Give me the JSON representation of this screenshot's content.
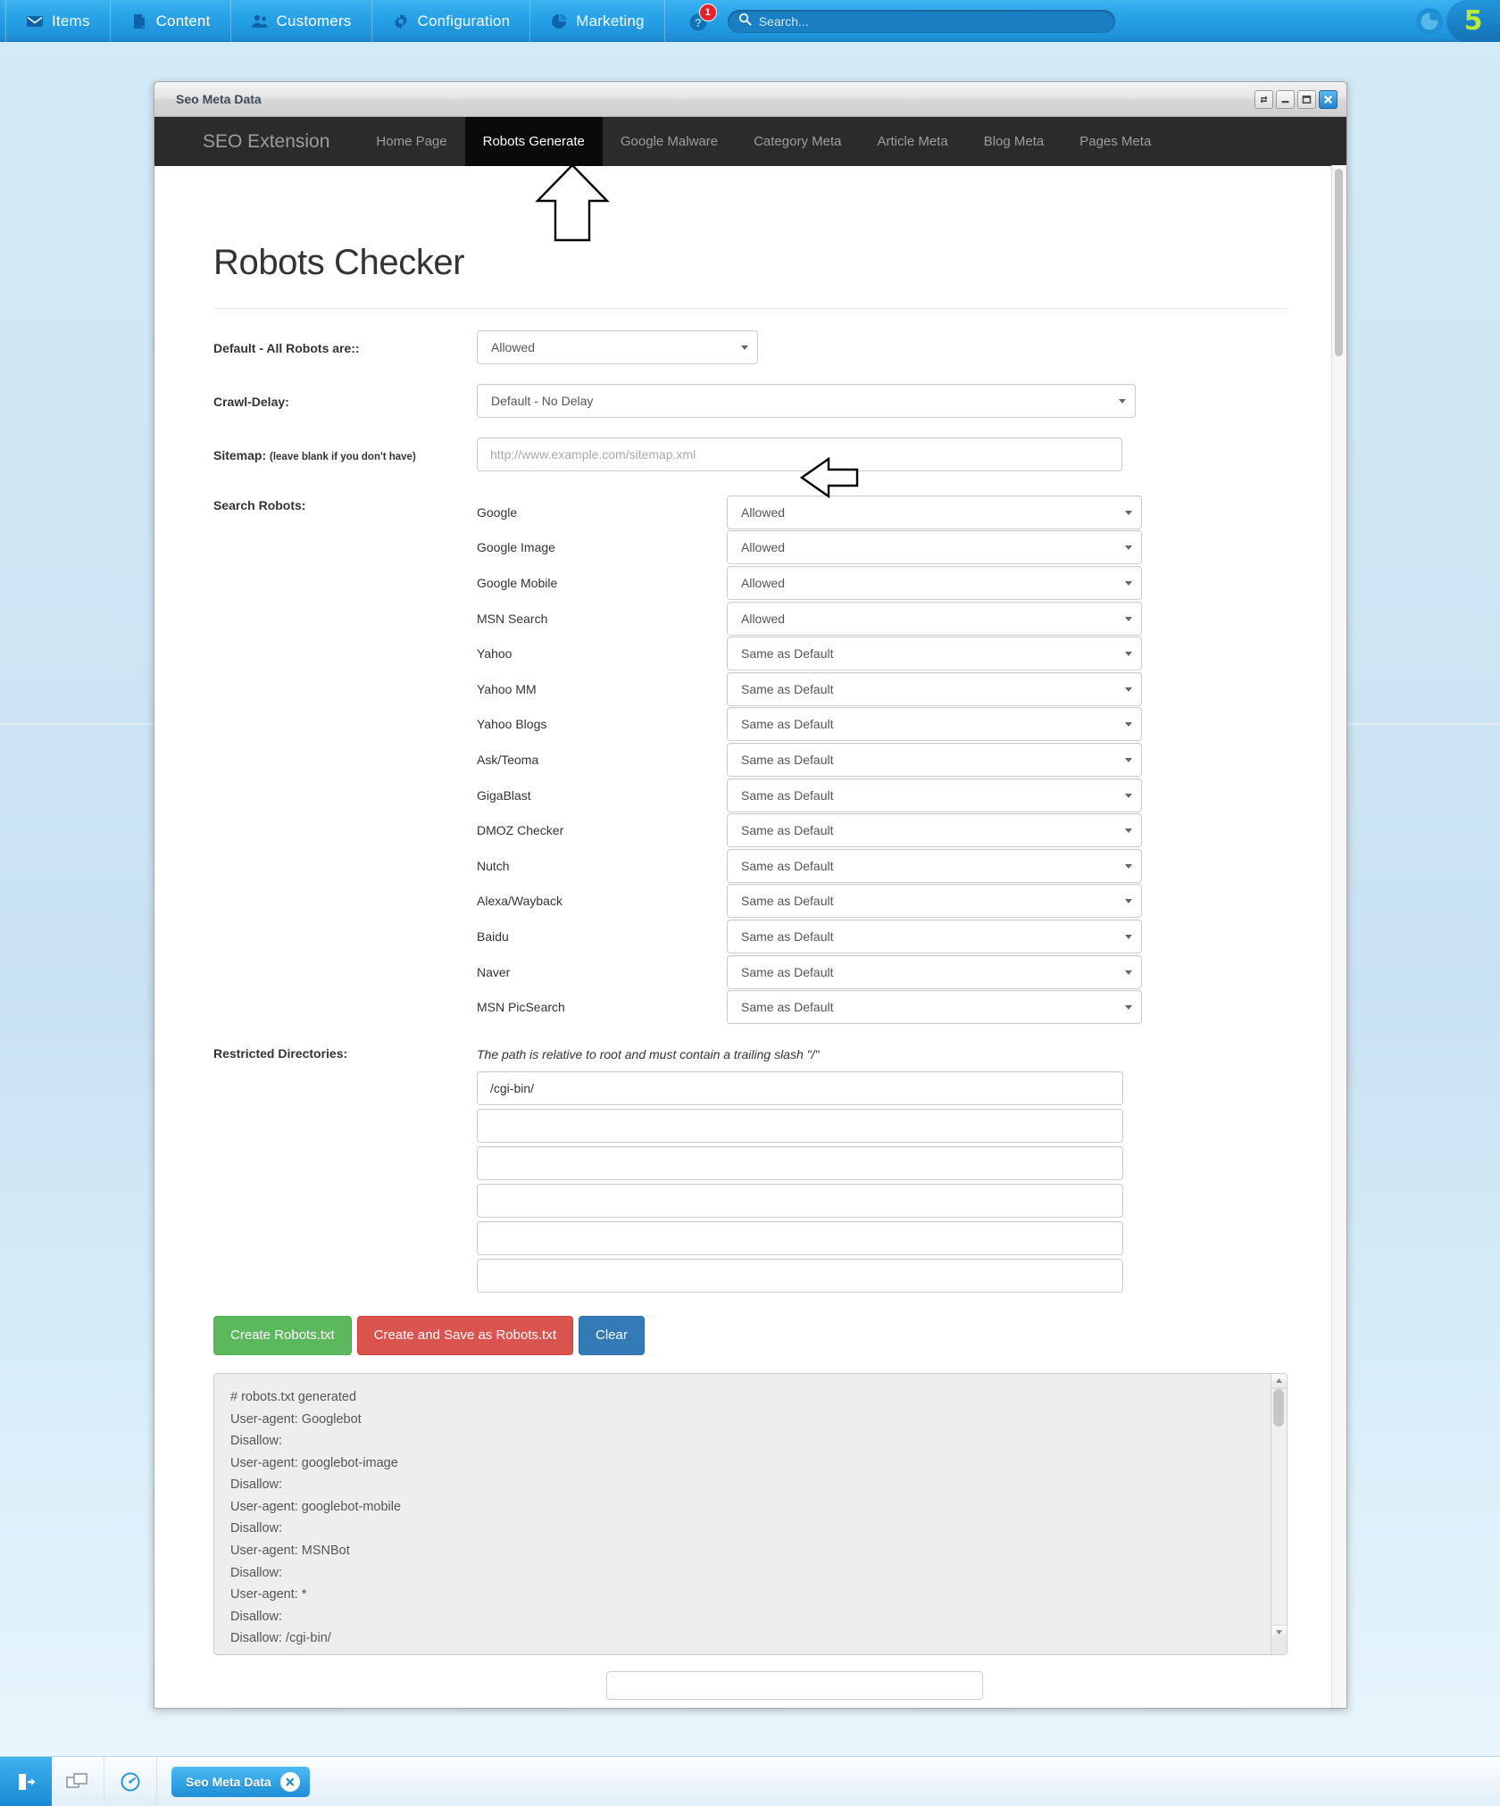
{
  "topbar": {
    "menu": [
      {
        "label": "Items",
        "icon": "inbox-icon"
      },
      {
        "label": "Content",
        "icon": "document-icon"
      },
      {
        "label": "Customers",
        "icon": "users-icon"
      },
      {
        "label": "Configuration",
        "icon": "gear-icon"
      },
      {
        "label": "Marketing",
        "icon": "pie-chart-icon"
      }
    ],
    "help_icon": "help-icon",
    "help_badge": "1",
    "search_placeholder": "Search...",
    "brand_mark": "5",
    "accent_color": "#1d8ed6",
    "badge_color": "#e8202a",
    "brand_color": "#b9e83b"
  },
  "window": {
    "title": "Seo Meta Data",
    "controls": [
      "restore-icon",
      "minimize-icon",
      "maximize-icon",
      "close-icon"
    ]
  },
  "nav": {
    "brand": "SEO Extension",
    "tabs": [
      {
        "label": "Home Page",
        "active": false
      },
      {
        "label": "Robots Generate",
        "active": true
      },
      {
        "label": "Google Malware",
        "active": false
      },
      {
        "label": "Category Meta",
        "active": false
      },
      {
        "label": "Article Meta",
        "active": false
      },
      {
        "label": "Blog Meta",
        "active": false
      },
      {
        "label": "Pages Meta",
        "active": false
      }
    ]
  },
  "page": {
    "title": "Robots Checker",
    "default_robots": {
      "label": "Default - All Robots are::",
      "value": "Allowed"
    },
    "crawl_delay": {
      "label": "Crawl-Delay:",
      "value": "Default - No Delay"
    },
    "sitemap": {
      "label": "Sitemap:",
      "sub_label": "(leave blank if you don't have)",
      "value": "",
      "placeholder": "http://www.example.com/sitemap.xml"
    },
    "search_robots": {
      "label": "Search Robots:",
      "rows": [
        {
          "name": "Google",
          "value": "Allowed"
        },
        {
          "name": "Google Image",
          "value": "Allowed"
        },
        {
          "name": "Google Mobile",
          "value": "Allowed"
        },
        {
          "name": "MSN Search",
          "value": "Allowed"
        },
        {
          "name": "Yahoo",
          "value": "Same as Default"
        },
        {
          "name": "Yahoo MM",
          "value": "Same as Default"
        },
        {
          "name": "Yahoo Blogs",
          "value": "Same as Default"
        },
        {
          "name": "Ask/Teoma",
          "value": "Same as Default"
        },
        {
          "name": "GigaBlast",
          "value": "Same as Default"
        },
        {
          "name": "DMOZ Checker",
          "value": "Same as Default"
        },
        {
          "name": "Nutch",
          "value": "Same as Default"
        },
        {
          "name": "Alexa/Wayback",
          "value": "Same as Default"
        },
        {
          "name": "Baidu",
          "value": "Same as Default"
        },
        {
          "name": "Naver",
          "value": "Same as Default"
        },
        {
          "name": "MSN PicSearch",
          "value": "Same as Default"
        }
      ]
    },
    "restricted": {
      "label": "Restricted Directories:",
      "hint": "The path is relative to root and must contain a trailing slash \"/\"",
      "values": [
        "/cgi-bin/",
        "",
        "",
        "",
        "",
        ""
      ]
    },
    "buttons": {
      "create": "Create Robots.txt",
      "create_save": "Create and Save as Robots.txt",
      "clear": "Clear",
      "create_color": "#5cb85c",
      "create_save_color": "#d9534f",
      "clear_color": "#337ab7"
    },
    "output": "# robots.txt generated\nUser-agent: Googlebot\nDisallow:\nUser-agent: googlebot-image\nDisallow:\nUser-agent: googlebot-mobile\nDisallow:\nUser-agent: MSNBot\nDisallow:\nUser-agent: *\nDisallow:\nDisallow: /cgi-bin/"
  },
  "taskbar": {
    "logout_icon": "logout-icon",
    "windows_icon": "windows-icon",
    "dashboard_icon": "gauge-icon",
    "task_label": "Seo Meta Data",
    "task_close": "✕"
  }
}
